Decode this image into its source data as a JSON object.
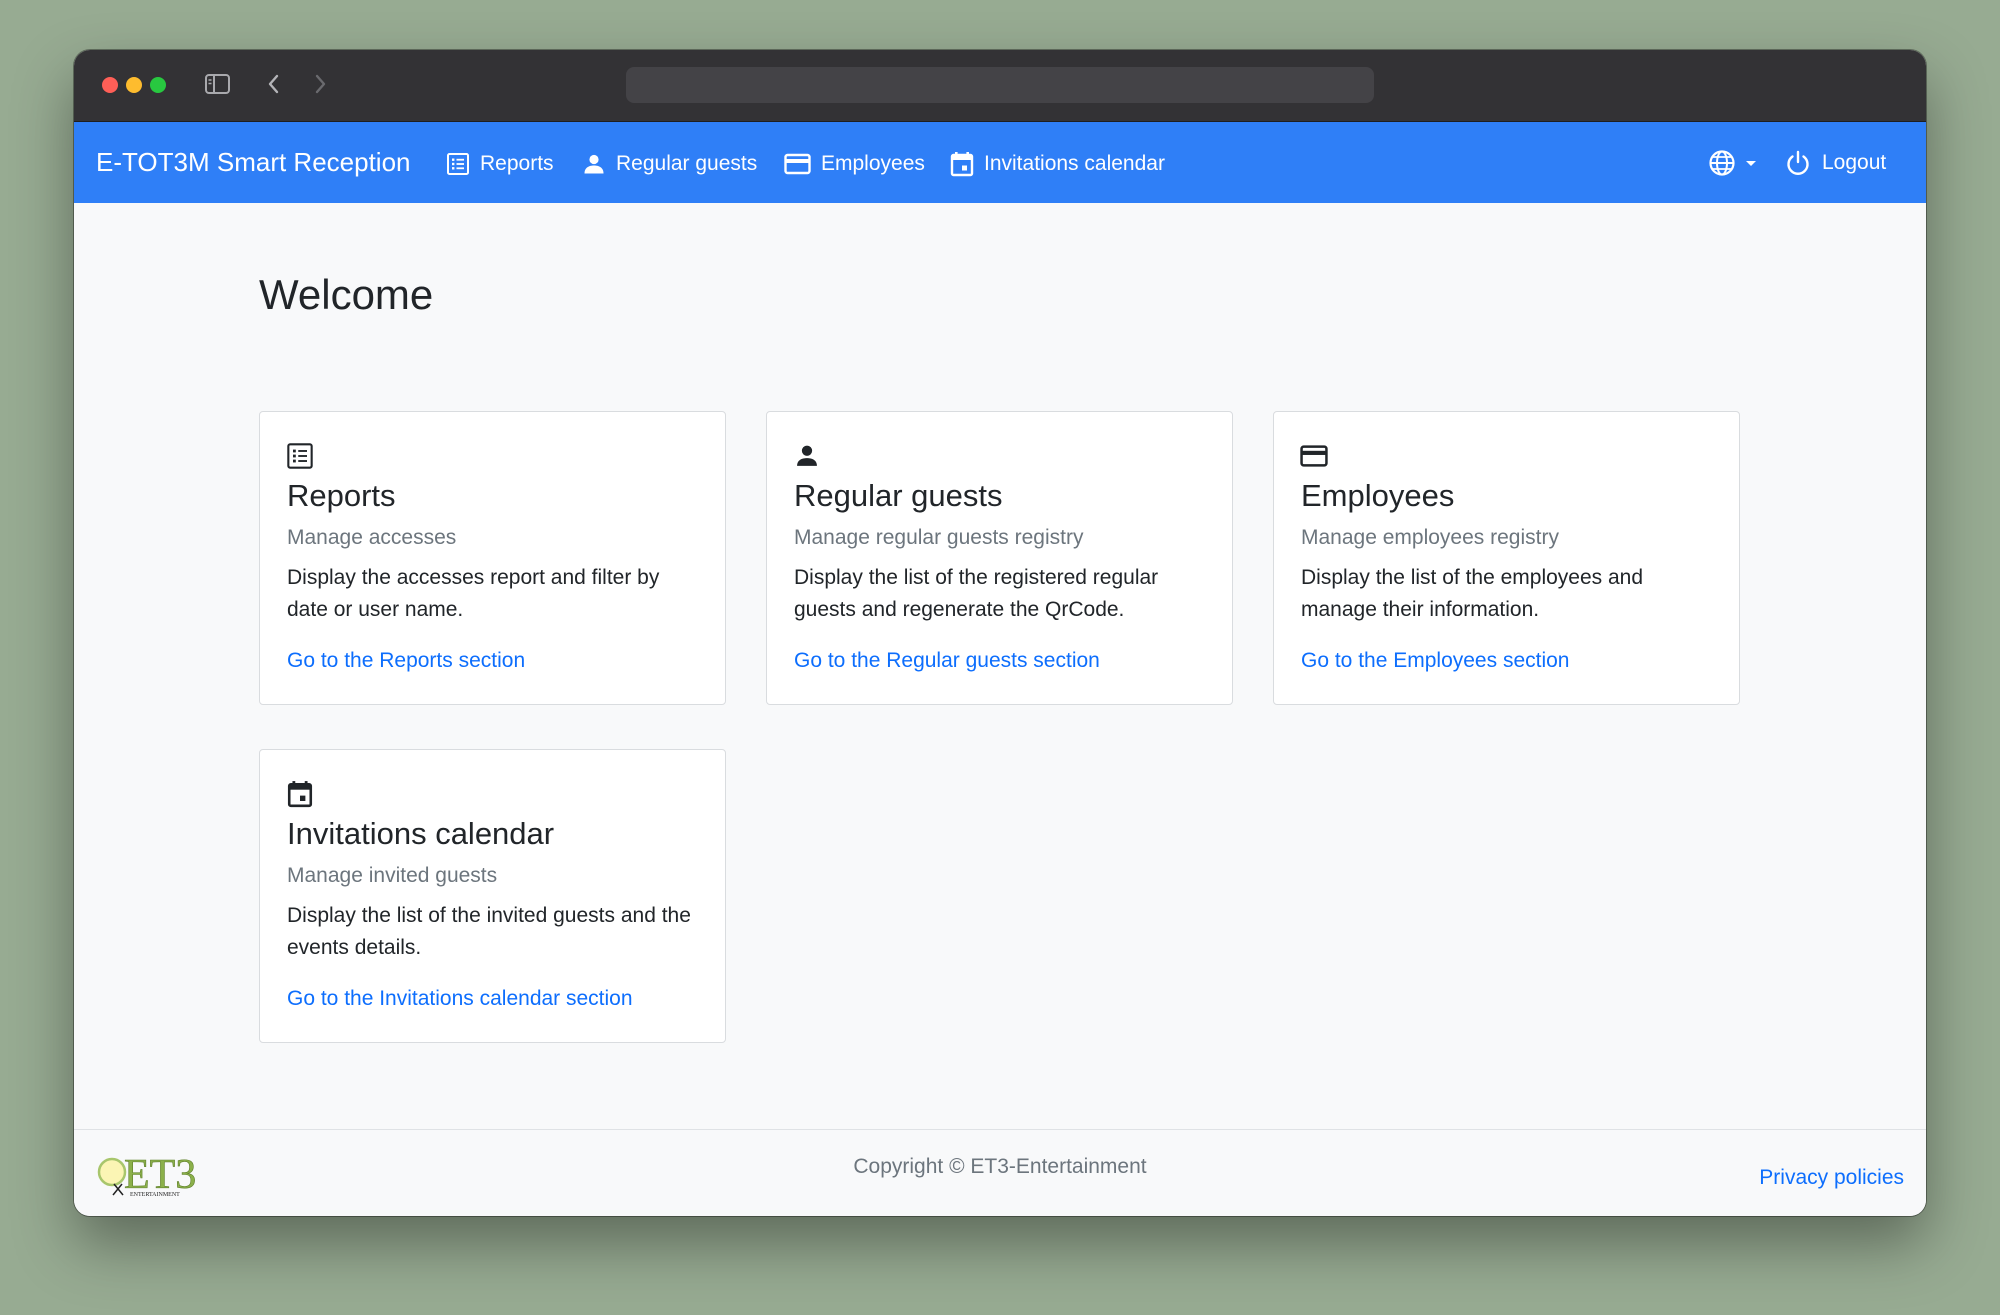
{
  "navbar": {
    "brand": "E-TOT3M Smart Reception",
    "items": [
      {
        "label": "Reports",
        "icon": "list-icon"
      },
      {
        "label": "Regular guests",
        "icon": "person-icon"
      },
      {
        "label": "Employees",
        "icon": "credit-card-icon"
      },
      {
        "label": "Invitations calendar",
        "icon": "calendar-icon"
      }
    ],
    "language_icon": "globe-icon",
    "logout_label": "Logout"
  },
  "main": {
    "heading": "Welcome",
    "cards": [
      {
        "icon": "list-icon",
        "title": "Reports",
        "subtitle": "Manage accesses",
        "text": "Display the accesses report and filter by date or user name.",
        "link": "Go to the Reports section"
      },
      {
        "icon": "person-icon",
        "title": "Regular guests",
        "subtitle": "Manage regular guests registry",
        "text": "Display the list of the registered regular guests and regenerate the QrCode.",
        "link": "Go to the Regular guests section"
      },
      {
        "icon": "credit-card-icon",
        "title": "Employees",
        "subtitle": "Manage employees registry",
        "text": "Display the list of the employees and manage their information.",
        "link": "Go to the Employees section"
      },
      {
        "icon": "calendar-icon",
        "title": "Invitations calendar",
        "subtitle": "Manage invited guests",
        "text": "Display the list of the invited guests and the events details.",
        "link": "Go to the Invitations calendar section"
      }
    ]
  },
  "footer": {
    "copyright": "Copyright © ET3-Entertainment",
    "privacy_label": "Privacy policies",
    "logo_text": "ET3",
    "logo_subtext": "ENTERTAINMENT"
  },
  "colors": {
    "navbar_bg": "#2f7ff7",
    "link": "#0d6efd",
    "background": "#97ab92"
  }
}
